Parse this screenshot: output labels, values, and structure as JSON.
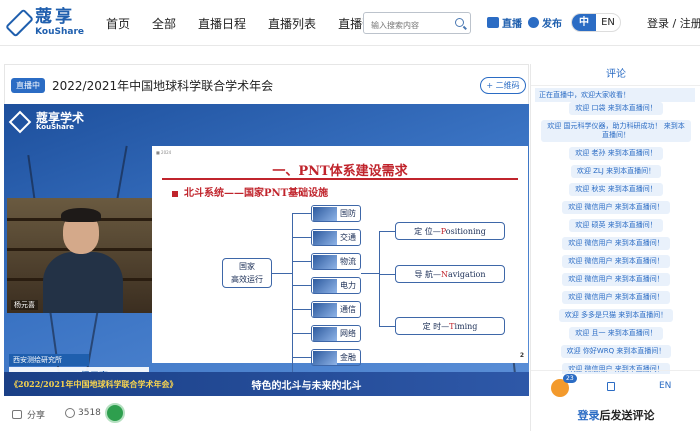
{
  "header": {
    "logo_cn": "蔻享",
    "logo_en": "KouShare",
    "nav": [
      "首页",
      "全部",
      "直播日程",
      "直播列表",
      "直播预约"
    ],
    "search_placeholder": "输入搜索内容",
    "live_label": "直播",
    "publish_label": "发布",
    "lang_cn": "中",
    "lang_en": "EN",
    "login": "登录 / 注册"
  },
  "stream": {
    "badge": "直播中",
    "title": "2022/2021年中国地球科学联合学术年会",
    "qr_label": "+ 二维码"
  },
  "video": {
    "logo_cn": "蔻享学术",
    "logo_en": "KouShare",
    "cam_name": "杨元喜",
    "org": "西安测绘研究所",
    "speaker": "杨元喜",
    "caption_left": "《2022/2021年中国地球科学联合学术年会》",
    "caption_right": "特色的北斗与未来的北斗",
    "slide": {
      "small": "■ 2024",
      "title": "一、PNT体系建设需求",
      "subtitle": "北斗系统——国家PNT基础设施",
      "left_box": [
        "国家",
        "高效运行"
      ],
      "items": [
        "国防",
        "交通",
        "物流",
        "电力",
        "通信",
        "网络",
        "金融"
      ],
      "outputs": [
        {
          "cn": "定  位—",
          "en_first": "P",
          "en_rest": "ositioning"
        },
        {
          "cn": "导  航—",
          "en_first": "N",
          "en_rest": "avigation"
        },
        {
          "cn": "定  时—",
          "en_first": "T",
          "en_rest": "iming"
        }
      ],
      "page": "2"
    }
  },
  "bottom": {
    "share": "分享",
    "views": "3518"
  },
  "comments": {
    "header": "评论",
    "notice": "正在直播中，欢迎大家收看！",
    "messages": [
      "欢迎 口袋 来到本直播间！",
      "欢迎 国元科学仪器，助力科研成功！ 来到本直播间！",
      "欢迎 老孙 来到本直播间！",
      "欢迎 ZLJ 来到本直播间！",
      "欢迎 秋实 来到本直播间！",
      "欢迎 微信用户 来到本直播间！",
      "欢迎 硕英 来到本直播间！",
      "欢迎 微信用户 来到本直播间！",
      "欢迎 微信用户 来到本直播间！",
      "欢迎 微信用户 来到本直播间！",
      "欢迎 微信用户 来到本直播间！",
      "欢迎 多多是只猫 来到本直播间！",
      "欢迎 且一 来到本直播间！",
      "欢迎 你好WRQ 来到本直播间！",
      "欢迎 微信用户 来到本直播间！"
    ],
    "like_count": "23",
    "en_label": "EN",
    "login_label": "登录",
    "send_label": "后发送评论"
  }
}
